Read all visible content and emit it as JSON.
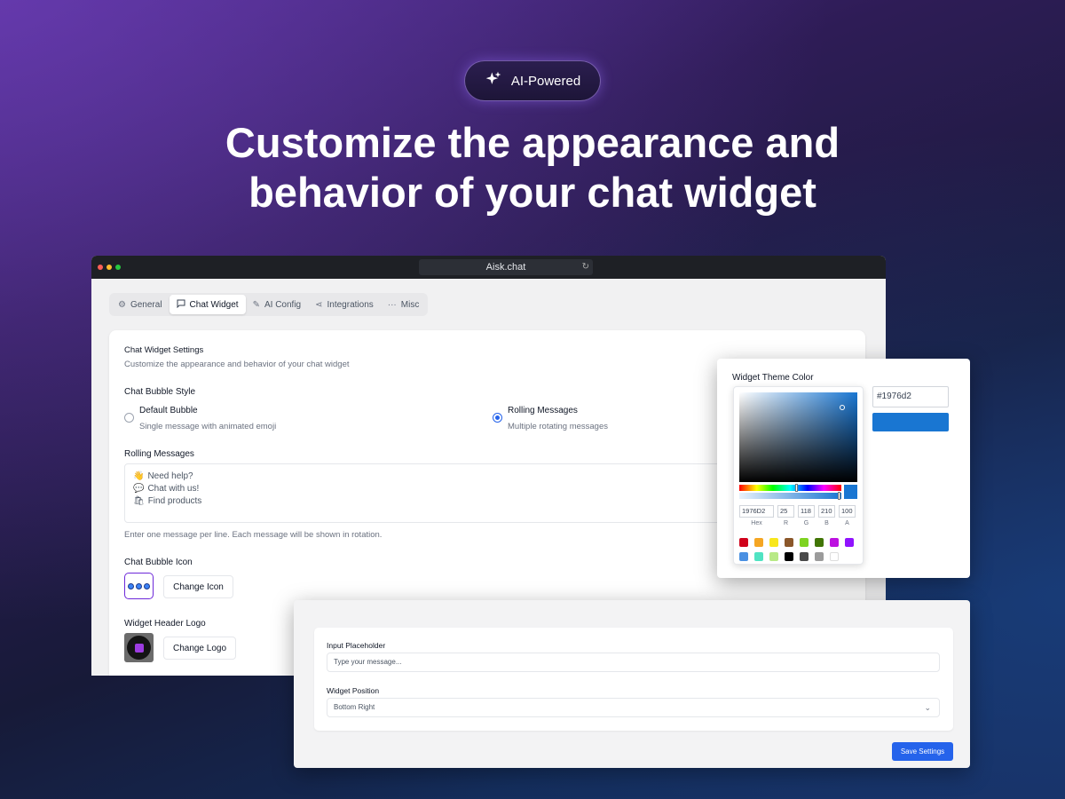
{
  "badge": {
    "icon": "sparkles-icon",
    "label": "AI-Powered"
  },
  "headline": {
    "line1": "Customize the appearance and",
    "line2": "behavior of your chat widget"
  },
  "browser": {
    "url": "Aisk.chat",
    "tabs": [
      {
        "icon": "gear-icon",
        "label": "General"
      },
      {
        "icon": "message-square-icon",
        "label": "Chat Widget",
        "active": true
      },
      {
        "icon": "magic-wand-icon",
        "label": "AI Config"
      },
      {
        "icon": "share-nodes-icon",
        "label": "Integrations"
      },
      {
        "icon": "ellipsis-icon",
        "label": "Misc"
      }
    ]
  },
  "settings": {
    "title": "Chat Widget Settings",
    "subtitle": "Customize the appearance and behavior of your chat widget",
    "bubble_style_label": "Chat Bubble Style",
    "options": [
      {
        "title": "Default Bubble",
        "desc": "Single message with animated emoji",
        "selected": false
      },
      {
        "title": "Rolling Messages",
        "desc": "Multiple rotating messages",
        "selected": true
      }
    ],
    "rolling_label": "Rolling Messages",
    "rolling_messages": [
      {
        "emoji": "👋",
        "text": "Need help?"
      },
      {
        "emoji": "💬",
        "text": "Chat with us!"
      },
      {
        "emoji": "🛍",
        "text": "Find products"
      }
    ],
    "rolling_help": "Enter one message per line. Each message will be shown in rotation.",
    "bubble_icon_label": "Chat Bubble Icon",
    "change_icon": "Change Icon",
    "header_logo_label": "Widget Header Logo",
    "change_logo": "Change Logo"
  },
  "theme_color": {
    "label": "Widget Theme Color",
    "hex_value": "#1976d2",
    "hex_input": "1976D2",
    "r": "25",
    "g": "118",
    "b": "210",
    "a": "100",
    "labels": {
      "hex": "Hex",
      "r": "R",
      "g": "G",
      "b": "B",
      "a": "A"
    },
    "swatches": [
      "#d0021b",
      "#f5a623",
      "#f8e71c",
      "#8b572a",
      "#7ed321",
      "#417505",
      "#bd10e0",
      "#9013fe",
      "#4a90e2",
      "#50e3c2",
      "#b8e986",
      "#000000",
      "#4a4a4a",
      "#9b9b9b",
      "#ffffff"
    ]
  },
  "bottom": {
    "placeholder_label": "Input Placeholder",
    "placeholder_value": "Type your message...",
    "position_label": "Widget Position",
    "position_value": "Bottom Right",
    "save": "Save Settings"
  }
}
